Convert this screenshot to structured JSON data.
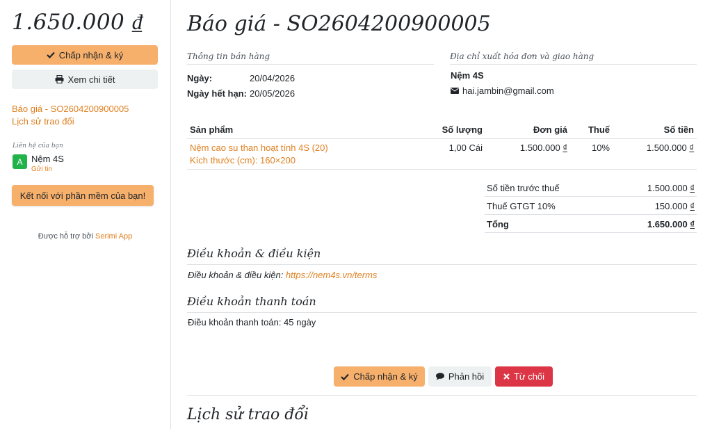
{
  "sidebar": {
    "total": "1.650.000 ₫",
    "accept_label": "Chấp nhận & ký",
    "view_label": "Xem chi tiết",
    "quote_link": "Báo giá - SO2604200900005",
    "history_link": "Lịch sử trao đổi",
    "contact_caption": "Liên hệ của bạn",
    "contact_initial": "A",
    "contact_name": "Nệm 4S",
    "contact_msg": "Gửi tin",
    "connect_label": "Kết nối với phần mềm của bạn!",
    "powered_prefix": "Được hỗ trợ bởi ",
    "powered_app": "Serimi App"
  },
  "main": {
    "title": "Báo giá - SO2604200900005",
    "sales_info_title": "Thông tin bán hàng",
    "date_label": "Ngày:",
    "date_value": "20/04/2026",
    "expiry_label": "Ngày hết hạn:",
    "expiry_value": "20/05/2026",
    "address_title": "Địa chỉ xuất hóa đơn và giao hàng",
    "customer_name": "Nệm 4S",
    "customer_email": "hai.jambin@gmail.com"
  },
  "table": {
    "headers": {
      "product": "Sản phẩm",
      "quantity": "Số lượng",
      "unit_price": "Đơn giá",
      "tax": "Thuế",
      "amount": "Số tiền"
    },
    "rows": [
      {
        "product_line1": "Nệm cao su than hoạt tính 4S (20)",
        "product_line2": "Kích thước (cm): 160×200",
        "quantity": "1,00 Cái",
        "unit_price": "1.500.000",
        "tax": "10%",
        "amount": "1.500.000"
      }
    ],
    "currency": "₫"
  },
  "totals": {
    "subtotal_label": "Số tiền trước thuế",
    "subtotal_value": "1.500.000",
    "vat_label": "Thuế GTGT 10%",
    "vat_value": "150.000",
    "total_label": "Tổng",
    "total_value": "1.650.000",
    "currency": "₫"
  },
  "terms": {
    "title": "Điều khoản & điều kiện",
    "label": "Điều khoản & điều kiện: ",
    "link": "https://nem4s.vn/terms"
  },
  "payment": {
    "title": "Điều khoản thanh toán",
    "text": "Điều khoản thanh toán: 45 ngày"
  },
  "actions": {
    "accept_label": "Chấp nhận & ký",
    "reply_label": "Phản hồi",
    "reject_label": "Từ chối"
  },
  "history": {
    "title": "Lịch sử trao đổi"
  },
  "colors": {
    "accent": "#f7b06b",
    "link": "#e07f1f",
    "danger": "#dc3545",
    "avatar": "#21b24a"
  }
}
